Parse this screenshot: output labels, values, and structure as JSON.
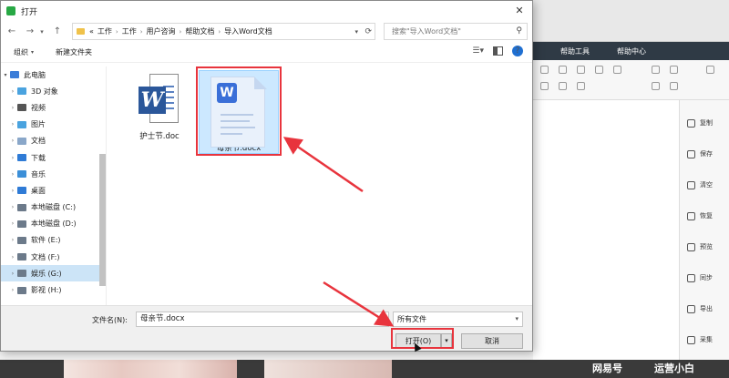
{
  "dialog": {
    "title": "打开",
    "close_glyph": "✕",
    "nav": {
      "back": "←",
      "forward": "→",
      "up": "↑"
    },
    "breadcrumb": [
      "工作",
      "工作",
      "用户咨询",
      "帮助文档",
      "导入Word文档"
    ],
    "breadcrumb_prefix": "«",
    "search_placeholder": "搜索\"导入Word文档\"",
    "commands": {
      "organize": "组织",
      "new_folder": "新建文件夹"
    },
    "sidebar": [
      {
        "label": "此电脑",
        "icon": "pc-icon",
        "color": "#3b7dd8"
      },
      {
        "label": "3D 对象",
        "icon": "cube-icon",
        "color": "#4aa3df"
      },
      {
        "label": "视频",
        "icon": "video-icon",
        "color": "#555555"
      },
      {
        "label": "图片",
        "icon": "picture-icon",
        "color": "#4aa3df"
      },
      {
        "label": "文档",
        "icon": "document-icon",
        "color": "#8aa7c9"
      },
      {
        "label": "下载",
        "icon": "download-icon",
        "color": "#2f7bd6"
      },
      {
        "label": "音乐",
        "icon": "music-icon",
        "color": "#3b8fd8"
      },
      {
        "label": "桌面",
        "icon": "desktop-icon",
        "color": "#2f7bd6"
      },
      {
        "label": "本地磁盘 (C:)",
        "icon": "drive-icon",
        "color": "#6c7a8a"
      },
      {
        "label": "本地磁盘 (D:)",
        "icon": "drive-icon",
        "color": "#6c7a8a"
      },
      {
        "label": "软件 (E:)",
        "icon": "drive-icon",
        "color": "#6c7a8a"
      },
      {
        "label": "文档 (F:)",
        "icon": "drive-icon",
        "color": "#6c7a8a"
      },
      {
        "label": "娱乐 (G:)",
        "icon": "drive-icon",
        "color": "#6c7a8a",
        "selected": true
      },
      {
        "label": "影视 (H:)",
        "icon": "drive-icon",
        "color": "#6c7a8a"
      }
    ],
    "files": [
      {
        "name": "护士节.doc",
        "icon": "word-doc-icon"
      },
      {
        "name": "母亲节.docx",
        "icon": "wps-docx-icon",
        "selected": true
      }
    ],
    "filename_label": "文件名(N):",
    "filename_value": "母亲节.docx",
    "filetype_value": "所有文件",
    "open_label": "打开(O)",
    "cancel_label": "取消"
  },
  "background_app": {
    "menu": [
      "帮助工具",
      "帮助中心"
    ],
    "side_actions": [
      "复制",
      "保存",
      "清空",
      "恢复",
      "预览",
      "同步",
      "导出",
      "采集"
    ],
    "watermarks": [
      "网易号",
      "运营小白"
    ]
  },
  "colors": {
    "highlight": "#e8343d",
    "selection": "#cce8ff",
    "word_blue": "#2b579a",
    "wps_blue": "#3a6fd8"
  }
}
